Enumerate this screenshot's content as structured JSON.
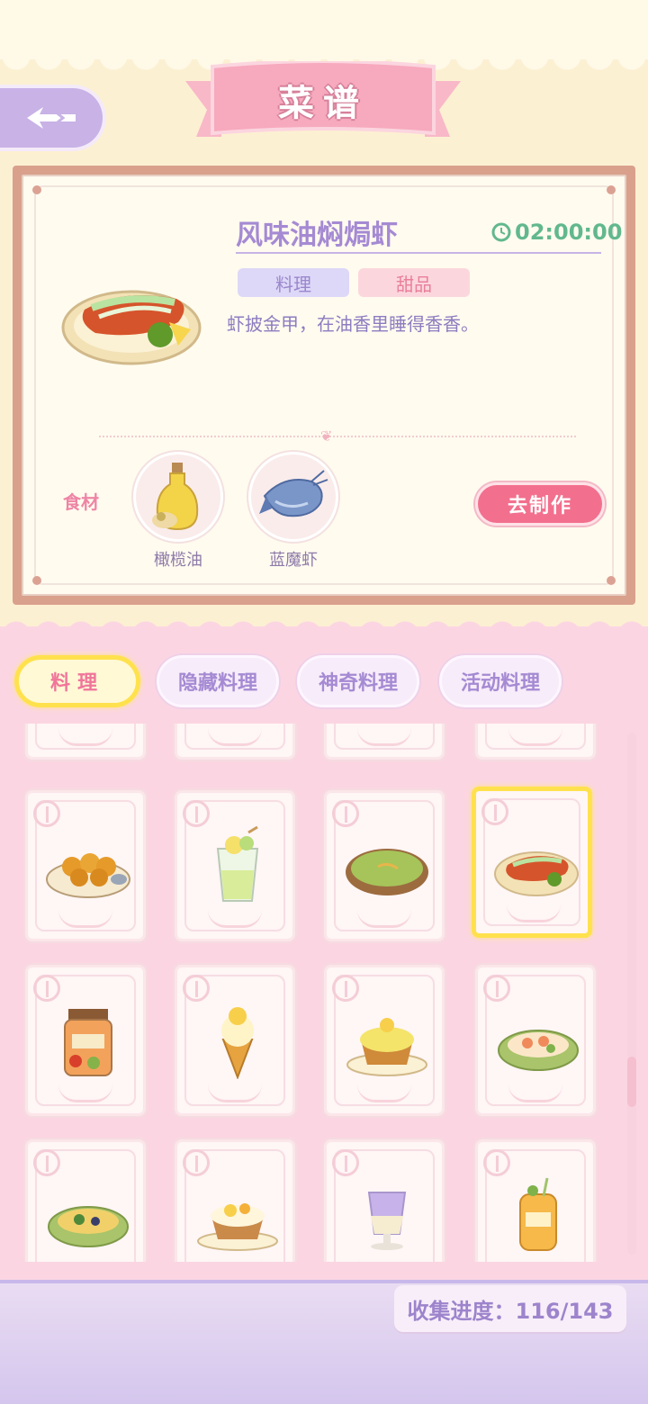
{
  "header": {
    "title": "菜谱"
  },
  "detail": {
    "name": "风味油焖焗虾",
    "timer": "02:00:00",
    "tags": [
      "料理",
      "甜品"
    ],
    "description": "虾披金甲，在油香里睡得香香。",
    "ingredients_label": "食材",
    "ingredients": [
      {
        "name": "橄榄油",
        "icon": "olive-oil-icon"
      },
      {
        "name": "蓝魔虾",
        "icon": "blue-shrimp-icon"
      }
    ],
    "make_button": "去制作"
  },
  "tabs": [
    "料理",
    "隐藏料理",
    "神奇料理",
    "活动料理"
  ],
  "active_tab": "料理",
  "recipes": {
    "rows": [
      [
        "fried-balls",
        "lemon-drink",
        "green-soup",
        "butter-shrimp"
      ],
      [
        "pickle-jar",
        "ice-cream-cone",
        "lemon-cupcake",
        "shrimp-salad"
      ],
      [
        "veggie-gratin",
        "fruit-tart",
        "purple-drink",
        "orange-juice-jar"
      ]
    ],
    "selected": "butter-shrimp"
  },
  "footer": {
    "progress_text": "收集进度：116/143"
  },
  "colors": {
    "accent_pink": "#f2708e",
    "accent_purple": "#a58ad3",
    "highlight_yellow": "#ffe14d",
    "timer_green": "#62b88e"
  }
}
